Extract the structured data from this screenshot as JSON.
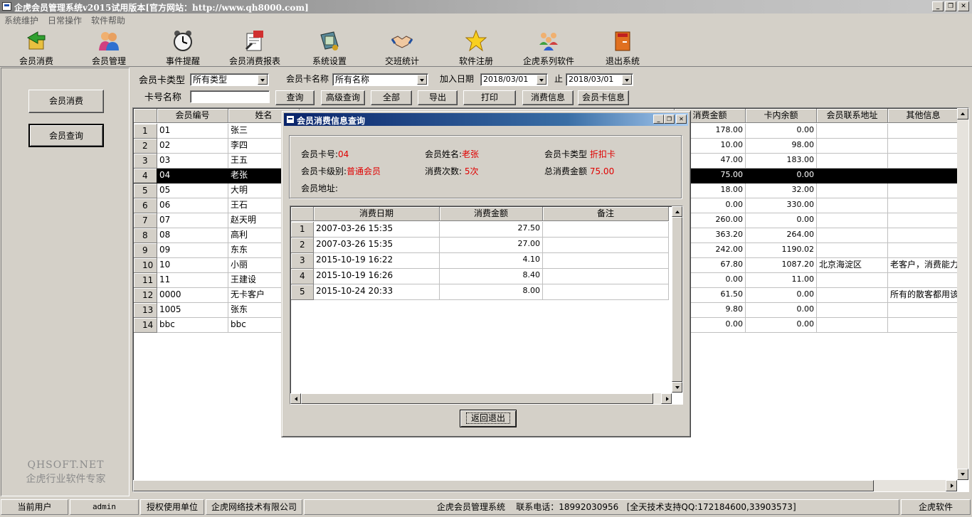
{
  "window": {
    "title": "企虎会员管理系统v2015试用版本[官方网站：http://www.qh8000.com]",
    "minimize": "_",
    "restore": "❐",
    "close": "✕"
  },
  "menu": [
    "系统维护",
    "日常操作",
    "软件帮助"
  ],
  "toolbar": [
    {
      "label": "会员消费",
      "icon": "member-consume-icon"
    },
    {
      "label": "会员管理",
      "icon": "members-icon"
    },
    {
      "label": "事件提醒",
      "icon": "alarm-clock-icon"
    },
    {
      "label": "会员消费报表",
      "icon": "report-icon"
    },
    {
      "label": "系统设置",
      "icon": "settings-icon"
    },
    {
      "label": "交班统计",
      "icon": "handshake-icon"
    },
    {
      "label": "软件注册",
      "icon": "star-icon"
    },
    {
      "label": "企虎系列软件",
      "icon": "group-icon"
    },
    {
      "label": "退出系统",
      "icon": "exit-door-icon"
    }
  ],
  "sidebar": {
    "buttons": [
      "会员消费",
      "会员查询"
    ],
    "brand_line1": "QHSOFT.NET",
    "brand_line2": "企虎行业软件专家"
  },
  "filters": {
    "card_type_label": "会员卡类型",
    "card_type_value": "所有类型",
    "card_name_label": "会员卡名称",
    "card_name_value": "所有名称",
    "join_date_label": "加入日期",
    "date_from": "2018/03/01",
    "to_label": "止",
    "date_to": "2018/03/01",
    "card_no_label": "卡号名称",
    "card_no_value": ""
  },
  "actions": [
    "查询",
    "高级查询",
    "全部",
    "导出",
    "打印",
    "消费信息",
    "会员卡信息"
  ],
  "grid": {
    "columns": [
      "会员编号",
      "姓名",
      "消费金额",
      "卡内余额",
      "会员联系地址",
      "其他信息"
    ],
    "rows": [
      {
        "n": "1",
        "id": "01",
        "name": "张三",
        "amount": "178.00",
        "balance": "0.00",
        "address": "",
        "other": ""
      },
      {
        "n": "2",
        "id": "02",
        "name": "李四",
        "amount": "10.00",
        "balance": "98.00",
        "address": "",
        "other": ""
      },
      {
        "n": "3",
        "id": "03",
        "name": "王五",
        "amount": "47.00",
        "balance": "183.00",
        "address": "",
        "other": ""
      },
      {
        "n": "4",
        "id": "04",
        "name": "老张",
        "amount": "75.00",
        "balance": "0.00",
        "address": "",
        "other": ""
      },
      {
        "n": "5",
        "id": "05",
        "name": "大明",
        "amount": "18.00",
        "balance": "32.00",
        "address": "",
        "other": ""
      },
      {
        "n": "6",
        "id": "06",
        "name": "王石",
        "amount": "0.00",
        "balance": "330.00",
        "address": "",
        "other": ""
      },
      {
        "n": "7",
        "id": "07",
        "name": "赵天明",
        "amount": "260.00",
        "balance": "0.00",
        "address": "",
        "other": ""
      },
      {
        "n": "8",
        "id": "08",
        "name": "高利",
        "amount": "363.20",
        "balance": "264.00",
        "address": "",
        "other": ""
      },
      {
        "n": "9",
        "id": "09",
        "name": "东东",
        "amount": "242.00",
        "balance": "1190.02",
        "address": "",
        "other": ""
      },
      {
        "n": "10",
        "id": "10",
        "name": "小丽",
        "amount": "67.80",
        "balance": "1087.20",
        "address": "北京海淀区",
        "other": "老客户，消费能力"
      },
      {
        "n": "11",
        "id": "11",
        "name": "王建设",
        "amount": "0.00",
        "balance": "11.00",
        "address": "",
        "other": ""
      },
      {
        "n": "12",
        "id": "0000",
        "name": "无卡客户",
        "amount": "61.50",
        "balance": "0.00",
        "address": "",
        "other": "所有的散客都用该"
      },
      {
        "n": "13",
        "id": "1005",
        "name": "张东",
        "amount": "9.80",
        "balance": "0.00",
        "address": "",
        "other": ""
      },
      {
        "n": "14",
        "id": "bbc",
        "name": "bbc",
        "amount": "0.00",
        "balance": "0.00",
        "address": "",
        "other": ""
      }
    ],
    "selected_row": "4"
  },
  "dialog": {
    "title": "会员消费信息查询",
    "card_no_label": "会员卡号:",
    "card_no": "04",
    "member_name_label": "会员姓名:",
    "member_name": "老张",
    "card_type_label": "会员卡类型",
    "card_type": "折扣卡",
    "card_level_label": "会员卡级别:",
    "card_level": "普通会员",
    "count_label": "消费次数:",
    "count": "5次",
    "total_label": "总消费金额",
    "total": "75.00",
    "address_label": "会员地址:",
    "address": "",
    "columns": [
      "消费日期",
      "消费金额",
      "备注"
    ],
    "rows": [
      {
        "n": "1",
        "date": "2007-03-26 15:35",
        "amount": "27.50",
        "note": ""
      },
      {
        "n": "2",
        "date": "2007-03-26 15:35",
        "amount": "27.00",
        "note": ""
      },
      {
        "n": "3",
        "date": "2015-10-19 16:22",
        "amount": "4.10",
        "note": ""
      },
      {
        "n": "4",
        "date": "2015-10-19 16:26",
        "amount": "8.40",
        "note": ""
      },
      {
        "n": "5",
        "date": "2015-10-24 20:33",
        "amount": "8.00",
        "note": ""
      }
    ],
    "back_button": "返回退出"
  },
  "status": {
    "user_label": "当前用户",
    "user": "admin",
    "licensee_label": "授权使用单位",
    "licensee": "企虎网络技术有限公司",
    "system": "企虎会员管理系统",
    "phone": "联系电话：18992030956",
    "support": "[全天技术支持QQ:172184600,33903573]",
    "right": "企虎软件"
  }
}
